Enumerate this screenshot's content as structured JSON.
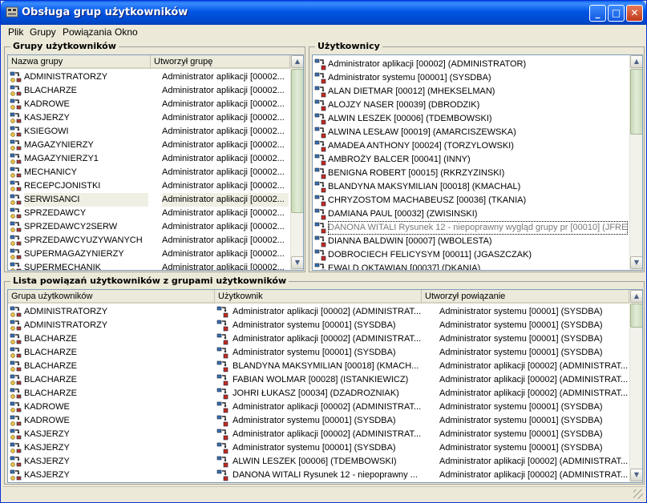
{
  "window": {
    "title": "Obsługa grup użytkowników",
    "btn_min": "_",
    "btn_max": "□",
    "btn_close": "✕"
  },
  "menu": [
    "Plik",
    "Grupy",
    "Powiązania",
    "Okno"
  ],
  "groups_panel": {
    "title": "Grupy użytkowników",
    "col_name": "Nazwa grupy",
    "col_creator": "Utworzył grupę",
    "rows": [
      {
        "name": "ADMINISTRATORZY",
        "creator": "Administrator aplikacji [00002..."
      },
      {
        "name": "BLACHARZE",
        "creator": "Administrator aplikacji [00002..."
      },
      {
        "name": "KADROWE",
        "creator": "Administrator aplikacji [00002..."
      },
      {
        "name": "KASJERZY",
        "creator": "Administrator aplikacji [00002..."
      },
      {
        "name": "KSIEGOWI",
        "creator": "Administrator aplikacji [00002..."
      },
      {
        "name": "MAGAZYNIERZY",
        "creator": "Administrator aplikacji [00002..."
      },
      {
        "name": "MAGAZYNIERZY1",
        "creator": "Administrator aplikacji [00002..."
      },
      {
        "name": "MECHANICY",
        "creator": "Administrator aplikacji [00002..."
      },
      {
        "name": "RECEPCJONISTKI",
        "creator": "Administrator aplikacji [00002..."
      },
      {
        "name": "SERWISANCI",
        "creator": "Administrator aplikacji [00002..."
      },
      {
        "name": "SPRZEDAWCY",
        "creator": "Administrator aplikacji [00002..."
      },
      {
        "name": "SPRZEDAWCY2SERW",
        "creator": "Administrator aplikacji [00002..."
      },
      {
        "name": "SPRZEDAWCYUZYWANYCH",
        "creator": "Administrator aplikacji [00002..."
      },
      {
        "name": "SUPERMAGAZYNIERZY",
        "creator": "Administrator aplikacji [00002..."
      },
      {
        "name": "SUPERMECHANIK",
        "creator": "Administrator aplikacji [00002..."
      }
    ],
    "selected_index": 9
  },
  "users_panel": {
    "title": "Użytkownicy",
    "rows": [
      "Administrator aplikacji [00002] (ADMINISTRATOR)",
      "Administrator systemu [00001] (SYSDBA)",
      "ALAN DIETMAR [00012] (MHEKSELMAN)",
      "ALOJZY NASER [00039] (DBRODZIK)",
      "ALWIN LESZEK [00006] (TDEMBOWSKI)",
      "ALWINA LESŁAW [00019] (AMARCISZEWSKA)",
      "AMADEA ANTHONY [00024] (TORZYLOWSKI)",
      "AMBROŻY BALCER [00041] (INNY)",
      "BENIGNA ROBERT [00015] (RKRZYZINSKI)",
      "BLANDYNA MAKSYMILIAN [00018] (KMACHAL)",
      "CHRYZOSTOM MACHABEUSZ [00036] (TKANIA)",
      "DAMIANA PAUL [00032] (ZWISINSKI)",
      "DANONA WITALI Rysunek 12 - niepoprawny wygląd grupy pr [00010] (JFRE...",
      "DIANNA BALDWIN [00007] (WBOLESTA)",
      "DOBROCIECH FELICYSYM [00011] (JGASZCZAK)",
      "EWALD OKTAWIAN [00037] (DKANIA)"
    ],
    "selected_index": 12
  },
  "links_panel": {
    "title": "Lista powiązań użytkowników z grupami użytkowników",
    "col_group": "Grupa użytkowników",
    "col_user": "Użytkownik",
    "col_creator": "Utworzył powiązanie",
    "rows": [
      {
        "group": "ADMINISTRATORZY",
        "user": "Administrator aplikacji [00002] (ADMINISTRAT...",
        "creator": "Administrator systemu [00001] (SYSDBA)"
      },
      {
        "group": "ADMINISTRATORZY",
        "user": "Administrator systemu [00001] (SYSDBA)",
        "creator": "Administrator systemu [00001] (SYSDBA)"
      },
      {
        "group": "BLACHARZE",
        "user": "Administrator aplikacji [00002] (ADMINISTRAT...",
        "creator": "Administrator systemu [00001] (SYSDBA)"
      },
      {
        "group": "BLACHARZE",
        "user": "Administrator systemu [00001] (SYSDBA)",
        "creator": "Administrator systemu [00001] (SYSDBA)"
      },
      {
        "group": "BLACHARZE",
        "user": "BLANDYNA MAKSYMILIAN [00018] (KMACH...",
        "creator": "Administrator aplikacji [00002] (ADMINISTRAT..."
      },
      {
        "group": "BLACHARZE",
        "user": "FABIAN WOLMAR [00028] (ISTANKIEWICZ)",
        "creator": "Administrator aplikacji [00002] (ADMINISTRAT..."
      },
      {
        "group": "BLACHARZE",
        "user": "JOHRI ŁUKASZ [00034] (DZADROZNIAK)",
        "creator": "Administrator aplikacji [00002] (ADMINISTRAT..."
      },
      {
        "group": "KADROWE",
        "user": "Administrator aplikacji [00002] (ADMINISTRAT...",
        "creator": "Administrator systemu [00001] (SYSDBA)"
      },
      {
        "group": "KADROWE",
        "user": "Administrator systemu [00001] (SYSDBA)",
        "creator": "Administrator systemu [00001] (SYSDBA)"
      },
      {
        "group": "KASJERZY",
        "user": "Administrator aplikacji [00002] (ADMINISTRAT...",
        "creator": "Administrator systemu [00001] (SYSDBA)"
      },
      {
        "group": "KASJERZY",
        "user": "Administrator systemu [00001] (SYSDBA)",
        "creator": "Administrator systemu [00001] (SYSDBA)"
      },
      {
        "group": "KASJERZY",
        "user": "ALWIN LESZEK [00006] (TDEMBOWSKI)",
        "creator": "Administrator aplikacji [00002] (ADMINISTRAT..."
      },
      {
        "group": "KASJERZY",
        "user": "DANONA WITALI Rysunek 12 - niepoprawny ...",
        "creator": "Administrator aplikacji [00002] (ADMINISTRAT..."
      }
    ]
  },
  "icons": {
    "group": "group-icon",
    "user": "user-icon",
    "app": "app-icon"
  },
  "colors": {
    "title_bar": "#0055e5",
    "list_border": "#7f9db9",
    "face": "#ece9d8"
  }
}
